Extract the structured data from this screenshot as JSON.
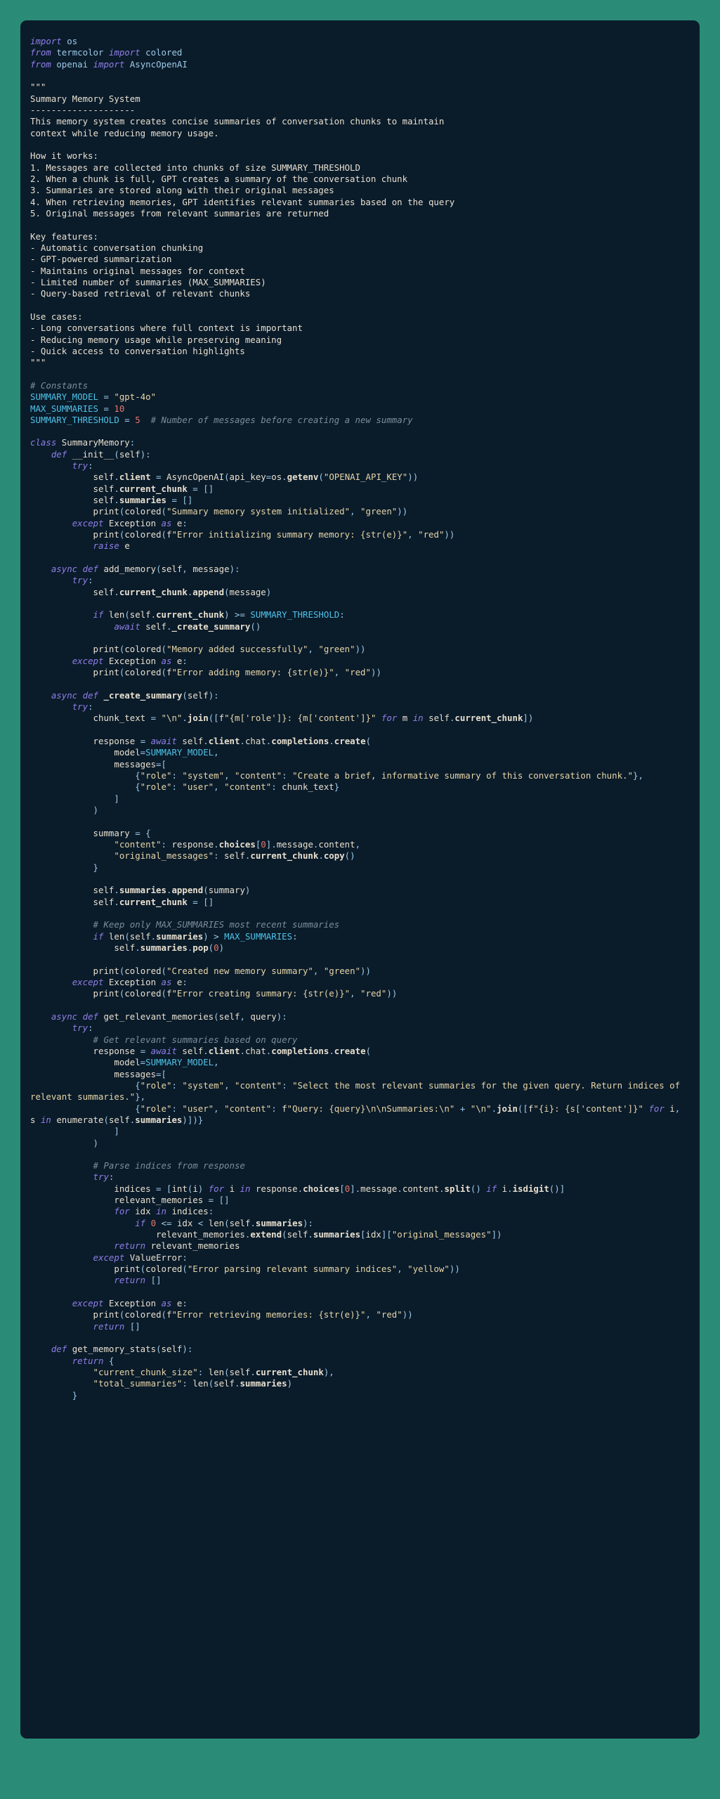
{
  "theme": {
    "page_background": "#2a8c77",
    "card_background": "#0a1b2a",
    "default_text": "#e8e0cf",
    "keyword": "#8f7fe8",
    "string": "#e6d5a7",
    "number": "#e8766d",
    "comment": "#7e8c99",
    "constant": "#4fc3e8",
    "identifier_blue": "#9ecbe8"
  },
  "language": "python",
  "code": {
    "title": "Summary Memory System",
    "imports": [
      "import os",
      "from termcolor import colored",
      "from openai import AsyncOpenAI"
    ],
    "docstring": {
      "heading": "Summary Memory System",
      "rule": "--------------------",
      "intro": [
        "This memory system creates concise summaries of conversation chunks to maintain",
        "context while reducing memory usage."
      ],
      "how_it_works_label": "How it works:",
      "how_it_works": [
        "1. Messages are collected into chunks of size SUMMARY_THRESHOLD",
        "2. When a chunk is full, GPT creates a summary of the conversation chunk",
        "3. Summaries are stored along with their original messages",
        "4. When retrieving memories, GPT identifies relevant summaries based on the query",
        "5. Original messages from relevant summaries are returned"
      ],
      "key_features_label": "Key features:",
      "key_features": [
        "- Automatic conversation chunking",
        "- GPT-powered summarization",
        "- Maintains original messages for context",
        "- Limited number of summaries (MAX_SUMMARIES)",
        "- Query-based retrieval of relevant chunks"
      ],
      "use_cases_label": "Use cases:",
      "use_cases": [
        "- Long conversations where full context is important",
        "- Reducing memory usage while preserving meaning",
        "- Quick access to conversation highlights"
      ]
    },
    "constants_comment": "# Constants",
    "constants": [
      {
        "name": "SUMMARY_MODEL",
        "value": "\"gpt-4o\""
      },
      {
        "name": "MAX_SUMMARIES",
        "value": "10"
      },
      {
        "name": "SUMMARY_THRESHOLD",
        "value": "5",
        "comment": "# Number of messages before creating a new summary"
      }
    ],
    "class_name": "SummaryMemory",
    "methods": [
      "__init__(self)",
      "add_memory(self, message)",
      "_create_summary(self)",
      "get_relevant_memories(self, query)",
      "get_memory_stats(self)"
    ],
    "messages": [
      "Summary memory system initialized",
      "Error initializing summary memory: {str(e)}",
      "Memory added successfully",
      "Error adding memory: {str(e)}",
      "Created new memory summary",
      "Error creating summary: {str(e)}",
      "Error parsing relevant summary indices",
      "Error retrieving memories: {str(e)}"
    ],
    "colors_used": [
      "green",
      "red",
      "yellow"
    ],
    "prompts": [
      "Create a brief, informative summary of this conversation chunk.",
      "Select the most relevant summaries for the given query. Return indices of relevant summaries."
    ],
    "inline_comments": [
      "# Keep only MAX_SUMMARIES most recent summaries",
      "# Get relevant summaries based on query",
      "# Parse indices from response"
    ],
    "stats_keys": [
      "current_chunk_size",
      "total_summaries"
    ],
    "summary_keys": [
      "content",
      "original_messages"
    ],
    "full_text": "import os\nfrom termcolor import colored\nfrom openai import AsyncOpenAI\n\n\"\"\"\nSummary Memory System\n--------------------\nThis memory system creates concise summaries of conversation chunks to maintain\ncontext while reducing memory usage.\n\nHow it works:\n1. Messages are collected into chunks of size SUMMARY_THRESHOLD\n2. When a chunk is full, GPT creates a summary of the conversation chunk\n3. Summaries are stored along with their original messages\n4. When retrieving memories, GPT identifies relevant summaries based on the query\n5. Original messages from relevant summaries are returned\n\nKey features:\n- Automatic conversation chunking\n- GPT-powered summarization\n- Maintains original messages for context\n- Limited number of summaries (MAX_SUMMARIES)\n- Query-based retrieval of relevant chunks\n\nUse cases:\n- Long conversations where full context is important\n- Reducing memory usage while preserving meaning\n- Quick access to conversation highlights\n\"\"\"\n\n# Constants\nSUMMARY_MODEL = \"gpt-4o\"\nMAX_SUMMARIES = 10\nSUMMARY_THRESHOLD = 5  # Number of messages before creating a new summary\n\nclass SummaryMemory:\n    def __init__(self):\n        try:\n            self.client = AsyncOpenAI(api_key=os.getenv(\"OPENAI_API_KEY\"))\n            self.current_chunk = []\n            self.summaries = []\n            print(colored(\"Summary memory system initialized\", \"green\"))\n        except Exception as e:\n            print(colored(f\"Error initializing summary memory: {str(e)}\", \"red\"))\n            raise e\n\n    async def add_memory(self, message):\n        try:\n            self.current_chunk.append(message)\n\n            if len(self.current_chunk) >= SUMMARY_THRESHOLD:\n                await self._create_summary()\n\n            print(colored(\"Memory added successfully\", \"green\"))\n        except Exception as e:\n            print(colored(f\"Error adding memory: {str(e)}\", \"red\"))\n\n    async def _create_summary(self):\n        try:\n            chunk_text = \"\\n\".join([f\"{m['role']}: {m['content']}\" for m in self.current_chunk])\n\n            response = await self.client.chat.completions.create(\n                model=SUMMARY_MODEL,\n                messages=[\n                    {\"role\": \"system\", \"content\": \"Create a brief, informative summary of this conversation chunk.\"},\n                    {\"role\": \"user\", \"content\": chunk_text}\n                ]\n            )\n\n            summary = {\n                \"content\": response.choices[0].message.content,\n                \"original_messages\": self.current_chunk.copy()\n            }\n\n            self.summaries.append(summary)\n            self.current_chunk = []\n\n            # Keep only MAX_SUMMARIES most recent summaries\n            if len(self.summaries) > MAX_SUMMARIES:\n                self.summaries.pop(0)\n\n            print(colored(\"Created new memory summary\", \"green\"))\n        except Exception as e:\n            print(colored(f\"Error creating summary: {str(e)}\", \"red\"))\n\n    async def get_relevant_memories(self, query):\n        try:\n            # Get relevant summaries based on query\n            response = await self.client.chat.completions.create(\n                model=SUMMARY_MODEL,\n                messages=[\n                    {\"role\": \"system\", \"content\": \"Select the most relevant summaries for the given query. Return indices of relevant summaries.\"},\n                    {\"role\": \"user\", \"content\": f\"Query: {query}\\n\\nSummaries:\\n\" + \"\\n\".join([f\"{i}: {s['content']}\" for i, s in enumerate(self.summaries)])}\n                ]\n            )\n\n            # Parse indices from response\n            try:\n                indices = [int(i) for i in response.choices[0].message.content.split() if i.isdigit()]\n                relevant_memories = []\n                for idx in indices:\n                    if 0 <= idx < len(self.summaries):\n                        relevant_memories.extend(self.summaries[idx][\"original_messages\"])\n                return relevant_memories\n            except ValueError:\n                print(colored(\"Error parsing relevant summary indices\", \"yellow\"))\n                return []\n\n        except Exception as e:\n            print(colored(f\"Error retrieving memories: {str(e)}\", \"red\"))\n            return []\n\n    def get_memory_stats(self):\n        return {\n            \"current_chunk_size\": len(self.current_chunk),\n            \"total_summaries\": len(self.summaries)\n        }"
  }
}
